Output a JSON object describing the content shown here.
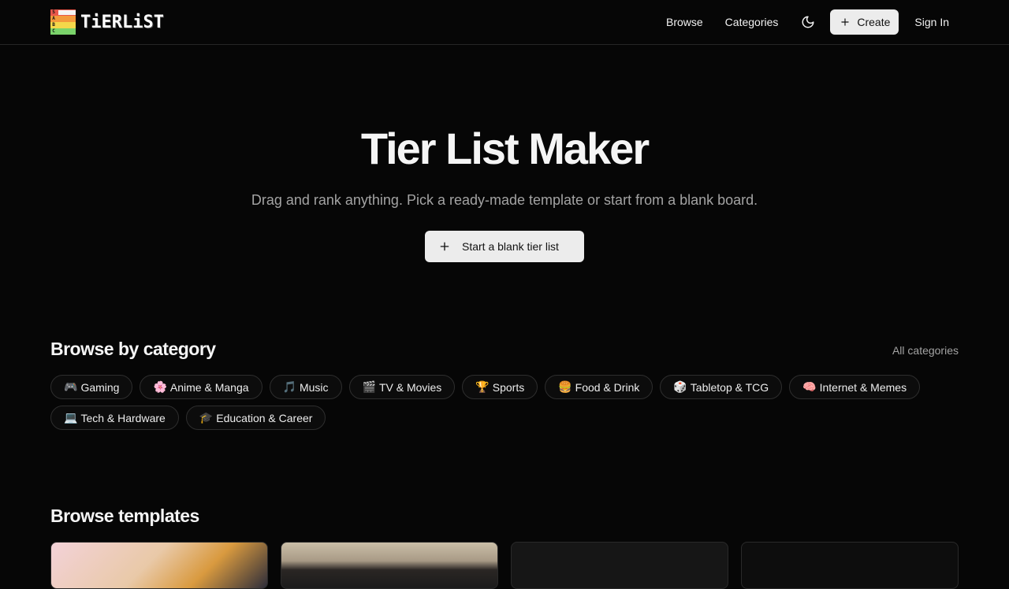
{
  "header": {
    "logo_text": "TiERLiST",
    "logo_tiers": [
      {
        "letter": "S",
        "color": "#e8574b"
      },
      {
        "letter": "A",
        "color": "#f39a3c"
      },
      {
        "letter": "B",
        "color": "#f4d84a"
      },
      {
        "letter": "C",
        "color": "#7ad36a"
      }
    ],
    "nav": {
      "browse": "Browse",
      "categories": "Categories",
      "create": "Create",
      "sign_in": "Sign In"
    }
  },
  "hero": {
    "title": "Tier List Maker",
    "subtitle": "Drag and rank anything. Pick a ready-made template or start from a blank board.",
    "cta": "Start a blank tier list"
  },
  "categories_section": {
    "title": "Browse by category",
    "all_link": "All categories",
    "items": [
      {
        "emoji": "🎮",
        "label": "Gaming"
      },
      {
        "emoji": "🌸",
        "label": "Anime & Manga"
      },
      {
        "emoji": "🎵",
        "label": "Music"
      },
      {
        "emoji": "🎬",
        "label": "TV & Movies"
      },
      {
        "emoji": "🏆",
        "label": "Sports"
      },
      {
        "emoji": "🍔",
        "label": "Food & Drink"
      },
      {
        "emoji": "🎲",
        "label": "Tabletop & TCG"
      },
      {
        "emoji": "🧠",
        "label": "Internet & Memes"
      },
      {
        "emoji": "💻",
        "label": "Tech & Hardware"
      },
      {
        "emoji": "🎓",
        "label": "Education & Career"
      }
    ]
  },
  "templates_section": {
    "title": "Browse templates"
  },
  "colors": {
    "background": "#060606",
    "button_bg": "#ececec",
    "muted_text": "#a3a3a3"
  }
}
